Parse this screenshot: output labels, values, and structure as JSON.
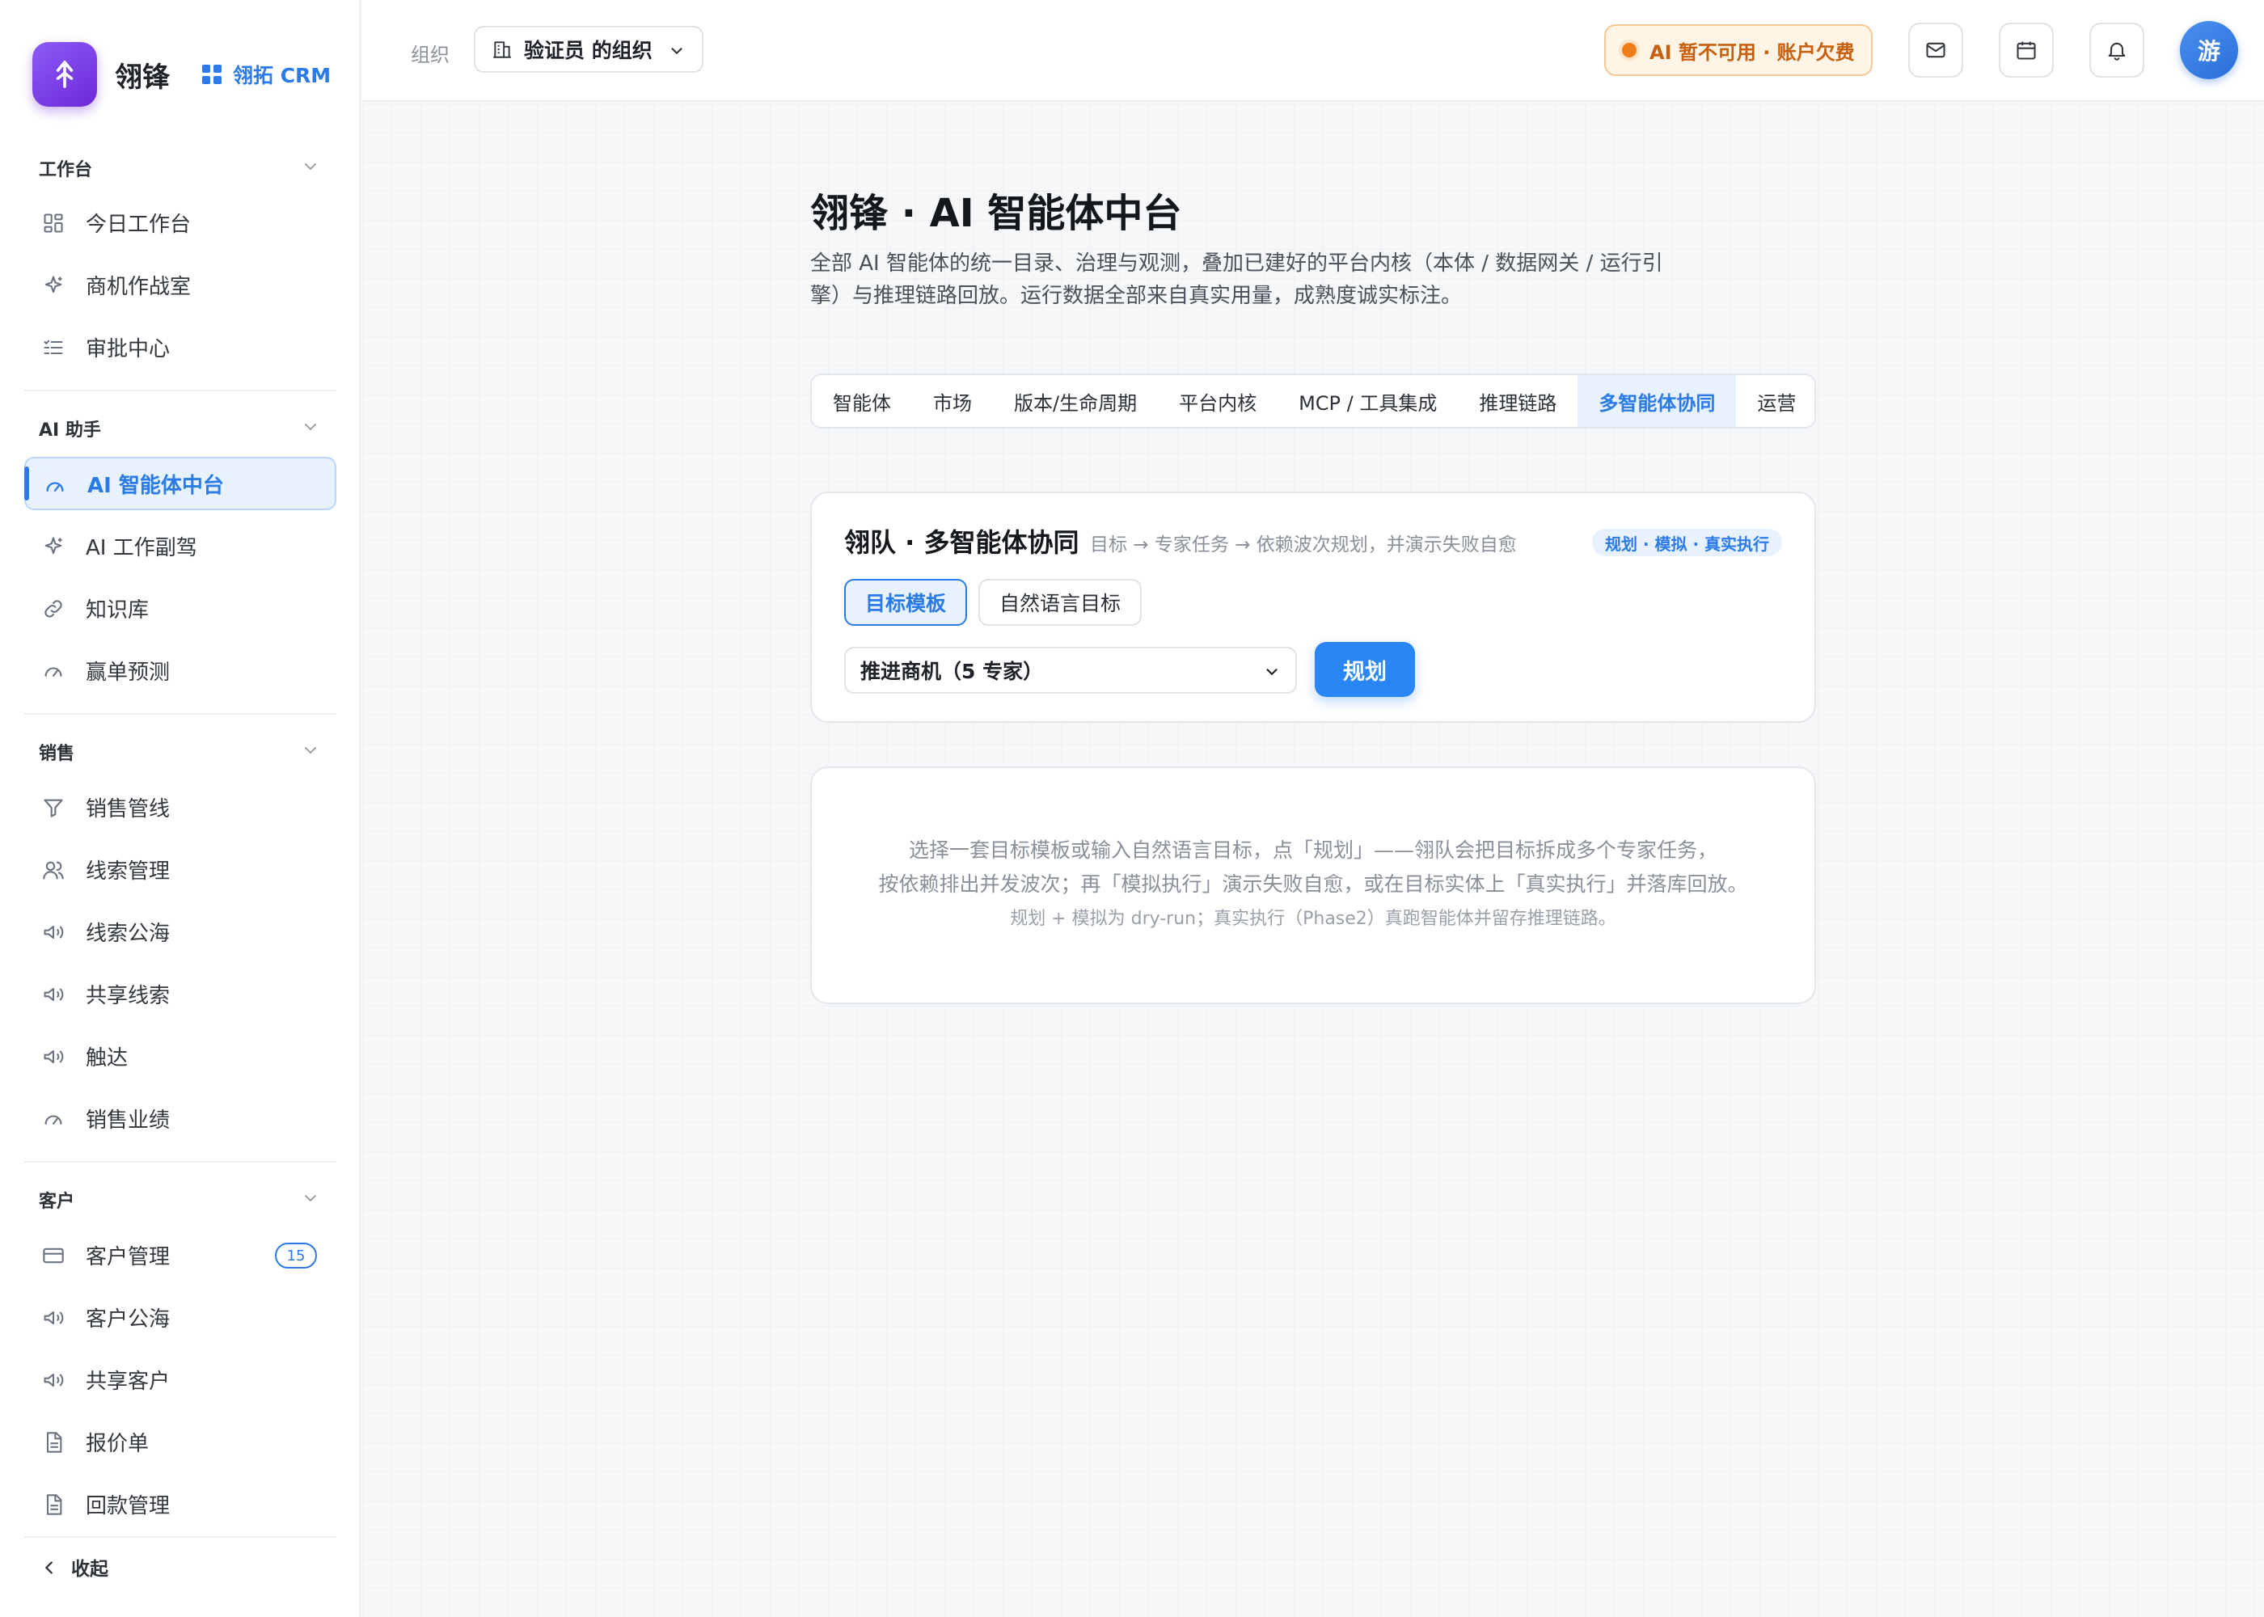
{
  "brand": {
    "name": "翎锋",
    "product": "翎拓 CRM"
  },
  "sidebar": {
    "groups": [
      {
        "title": "工作台",
        "items": [
          {
            "label": "今日工作台",
            "icon": "dashboard-icon"
          },
          {
            "label": "商机作战室",
            "icon": "sparkle-icon"
          },
          {
            "label": "审批中心",
            "icon": "list-check-icon"
          }
        ]
      },
      {
        "title": "AI 助手",
        "items": [
          {
            "label": "AI 智能体中台",
            "icon": "gauge-icon",
            "active": true
          },
          {
            "label": "AI 工作副驾",
            "icon": "sparkle-icon"
          },
          {
            "label": "知识库",
            "icon": "link-icon"
          },
          {
            "label": "赢单预测",
            "icon": "gauge-icon"
          }
        ]
      },
      {
        "title": "销售",
        "items": [
          {
            "label": "销售管线",
            "icon": "funnel-icon"
          },
          {
            "label": "线索管理",
            "icon": "users-icon"
          },
          {
            "label": "线索公海",
            "icon": "megaphone-icon"
          },
          {
            "label": "共享线索",
            "icon": "megaphone-icon"
          },
          {
            "label": "触达",
            "icon": "megaphone-icon"
          },
          {
            "label": "销售业绩",
            "icon": "gauge-icon"
          }
        ]
      },
      {
        "title": "客户",
        "items": [
          {
            "label": "客户管理",
            "icon": "card-icon",
            "badge": "15"
          },
          {
            "label": "客户公海",
            "icon": "megaphone-icon"
          },
          {
            "label": "共享客户",
            "icon": "megaphone-icon"
          },
          {
            "label": "报价单",
            "icon": "document-icon"
          },
          {
            "label": "回款管理",
            "icon": "document-icon"
          }
        ]
      }
    ],
    "collapse_label": "收起"
  },
  "header": {
    "org_label": "组织",
    "org_value": "验证员 的组织",
    "ai_status": "AI 暂不可用 · 账户欠费",
    "avatar_text": "游"
  },
  "page": {
    "title": "翎锋 · AI 智能体中台",
    "description": "全部 AI 智能体的统一目录、治理与观测，叠加已建好的平台内核（本体 / 数据网关 / 运行引擎）与推理链路回放。运行数据全部来自真实用量，成熟度诚实标注。",
    "tabs": [
      {
        "label": "智能体"
      },
      {
        "label": "市场"
      },
      {
        "label": "版本/生命周期"
      },
      {
        "label": "平台内核"
      },
      {
        "label": "MCP / 工具集成"
      },
      {
        "label": "推理链路"
      },
      {
        "label": "多智能体协同",
        "active": true
      },
      {
        "label": "运营"
      }
    ]
  },
  "team_card": {
    "title": "翎队 · 多智能体协同",
    "subtitle": "目标 → 专家任务 → 依赖波次规划，并演示失败自愈",
    "pill": "规划 · 模拟 · 真实执行",
    "mode_template": "目标模板",
    "mode_natural": "自然语言目标",
    "template_selected": "推进商机（5 专家）",
    "plan_button": "规划"
  },
  "hint_card": {
    "line1": "选择一套目标模板或输入自然语言目标，点「规划」——翎队会把目标拆成多个专家任务，",
    "line2": "按依赖排出并发波次；再「模拟执行」演示失败自愈，或在目标实体上「真实执行」并落库回放。",
    "line3": "规划 + 模拟为 dry-run；真实执行（Phase2）真跑智能体并留存推理链路。"
  },
  "colors": {
    "accent": "#2a7be8",
    "warning": "#c85f0c",
    "brand": "#7c3aed"
  }
}
